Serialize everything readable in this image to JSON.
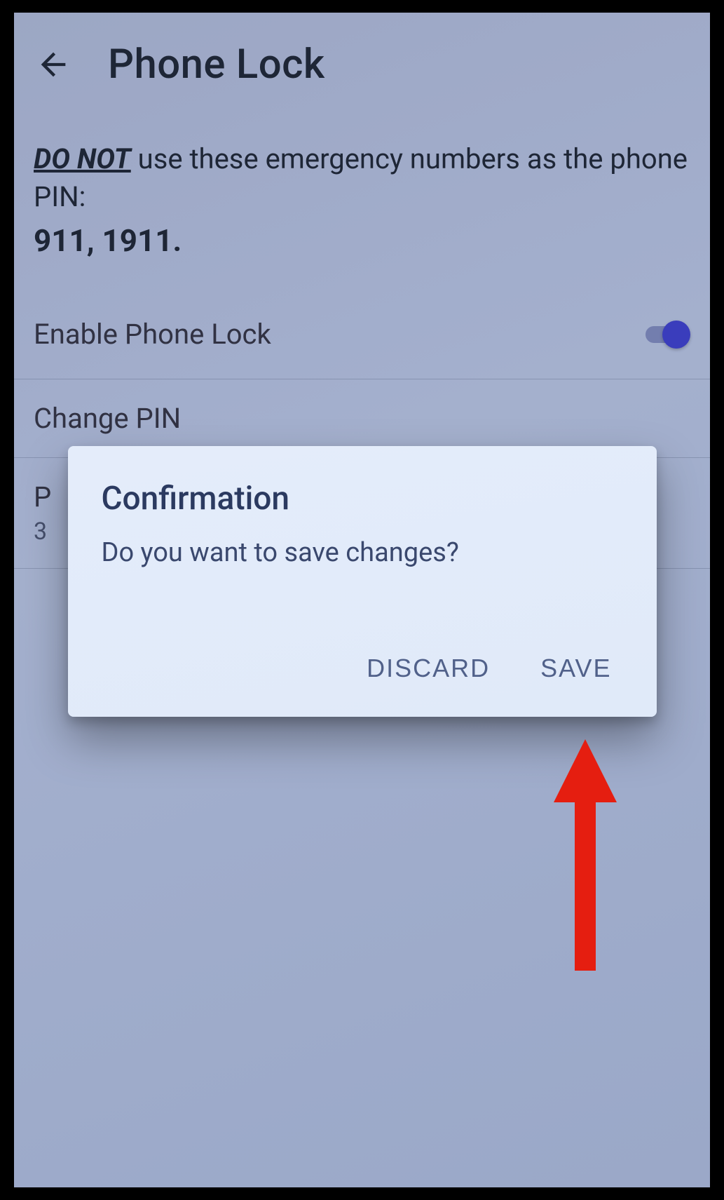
{
  "appbar": {
    "title": "Phone Lock"
  },
  "warning": {
    "donot": "DO NOT",
    "text_a": " use these emergency numbers as the phone PIN:",
    "numbers": "911, 1911."
  },
  "rows": {
    "enable": {
      "label": "Enable Phone Lock",
      "toggle_on": true
    },
    "change_pin": {
      "label": "Change PIN"
    },
    "third": {
      "label_partial": "P",
      "sub_partial": "3"
    }
  },
  "dialog": {
    "title": "Confirmation",
    "message": "Do you want to save changes?",
    "discard": "DISCARD",
    "save": "SAVE"
  },
  "annotation": {
    "arrow_color": "#e51e10"
  }
}
